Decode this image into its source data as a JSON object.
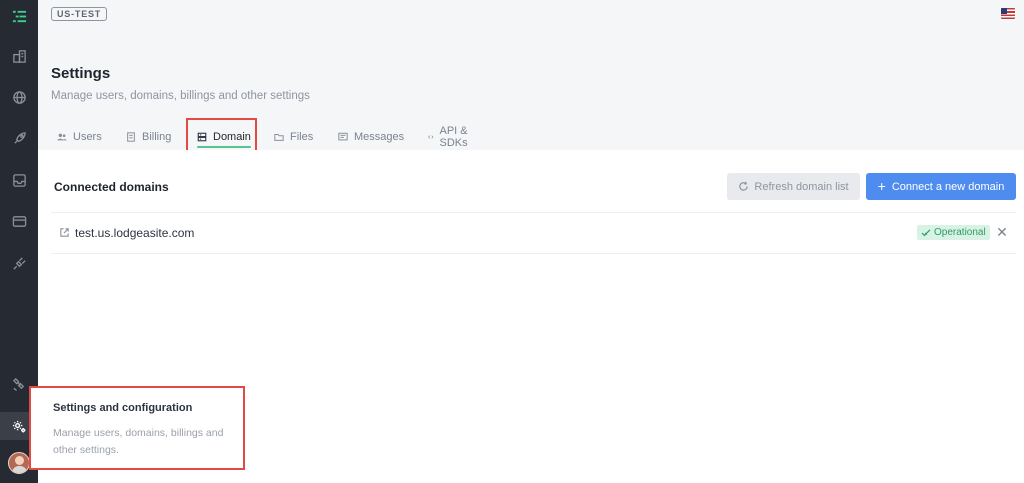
{
  "app": {
    "env_badge": "US-TEST",
    "locale_flag": "us-flag-icon"
  },
  "sidebar": {
    "items": [
      {
        "icon": "menu-icon",
        "active": false
      },
      {
        "icon": "building-icon",
        "active": false
      },
      {
        "icon": "globe-icon",
        "active": false
      },
      {
        "icon": "rocket-icon",
        "active": false
      },
      {
        "icon": "inbox-icon",
        "active": false
      },
      {
        "icon": "credit-card-icon",
        "active": false
      },
      {
        "icon": "plug-icon",
        "active": false
      },
      {
        "icon": "satellite-icon",
        "active": false
      },
      {
        "icon": "gear-icon",
        "active": true
      }
    ],
    "avatar": "avatar"
  },
  "header": {
    "title": "Settings",
    "subtitle": "Manage users, domains, billings and other settings"
  },
  "tabs": [
    {
      "label": "Users",
      "icon": "users-icon",
      "active": false
    },
    {
      "label": "Billing",
      "icon": "receipt-icon",
      "active": false
    },
    {
      "label": "Domain",
      "icon": "server-icon",
      "active": true
    },
    {
      "label": "Files",
      "icon": "folder-icon",
      "active": false
    },
    {
      "label": "Messages",
      "icon": "message-icon",
      "active": false
    },
    {
      "label": "API & SDKs",
      "icon": "code-icon",
      "active": false
    }
  ],
  "domains_section": {
    "title": "Connected domains",
    "refresh_label": "Refresh domain list",
    "connect_label": "Connect a new domain",
    "rows": [
      {
        "domain": "test.us.lodgeasite.com",
        "status": "Operational"
      }
    ]
  },
  "tooltip": {
    "title": "Settings and configuration",
    "text": "Manage users, domains, billings and other settings."
  },
  "colors": {
    "sidebar_bg": "#262b33",
    "accent_green": "#56c28e",
    "primary_blue": "#4f8cf0",
    "highlight_red": "#e24a43",
    "status_green_bg": "#d8f3e5"
  }
}
